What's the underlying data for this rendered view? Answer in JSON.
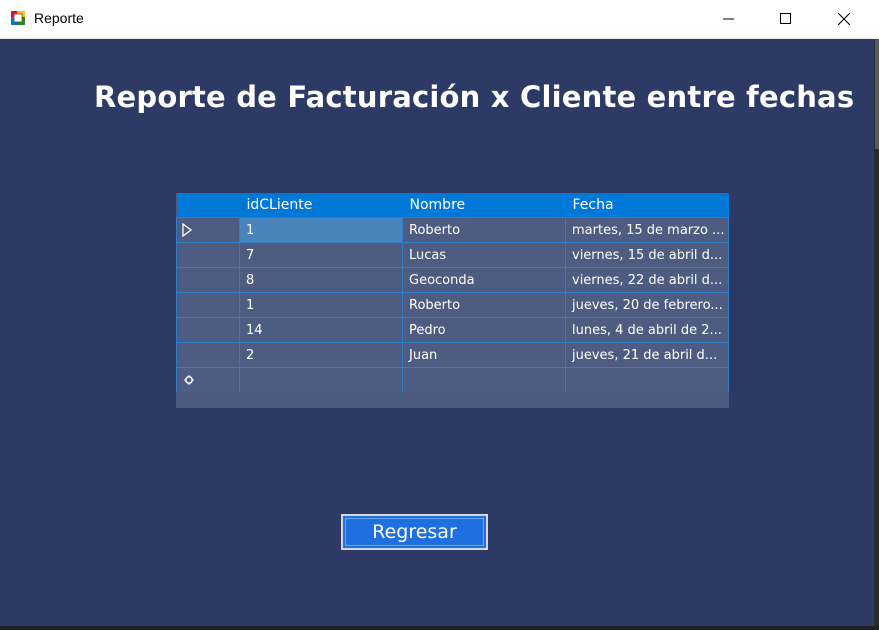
{
  "window": {
    "title": "Reporte",
    "icon": "windows-form-icon",
    "controls": [
      "minimize-icon",
      "maximize-icon",
      "close-icon"
    ]
  },
  "report": {
    "title": "Reporte de Facturación x Cliente entre fechas"
  },
  "grid": {
    "columns": [
      "idCLiente",
      "Nombre",
      "Fecha"
    ],
    "rows": [
      {
        "id": "1",
        "nombre": "Roberto",
        "fecha": "martes, 15 de marzo ..."
      },
      {
        "id": "7",
        "nombre": "Lucas",
        "fecha": "viernes, 15 de abril d..."
      },
      {
        "id": "8",
        "nombre": "Geoconda",
        "fecha": "viernes, 22 de abril d..."
      },
      {
        "id": "1",
        "nombre": "Roberto",
        "fecha": "jueves, 20 de febrero..."
      },
      {
        "id": "14",
        "nombre": "Pedro",
        "fecha": "lunes, 4 de abril de 2..."
      },
      {
        "id": "2",
        "nombre": "Juan",
        "fecha": "jueves, 21 de abril d..."
      }
    ],
    "current_row_icon": "current-row-arrow-icon",
    "new_row_icon": "new-row-icon"
  },
  "buttons": {
    "back_label": "Regresar"
  },
  "colors": {
    "background": "#2d3a66",
    "header": "#0078d7",
    "cell": "#4f5c82",
    "selected_cell": "#4a84bc",
    "button": "#1f6fe0"
  }
}
